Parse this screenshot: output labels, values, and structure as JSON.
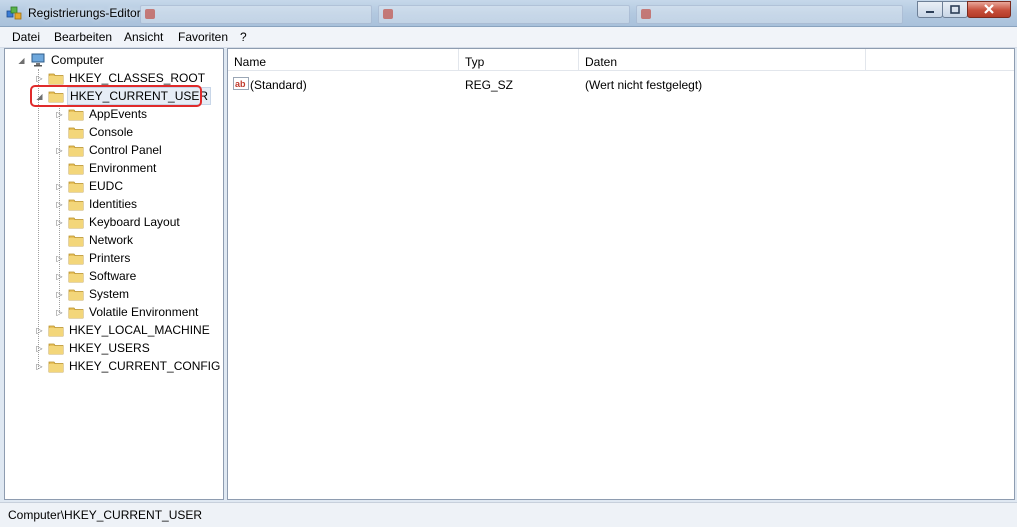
{
  "window": {
    "title": "Registrierungs-Editor",
    "buttons": {
      "minimize": "minimize",
      "maximize": "maximize",
      "close": "close"
    }
  },
  "menu": {
    "items": [
      {
        "label": "Datei"
      },
      {
        "label": "Bearbeiten"
      },
      {
        "label": "Ansicht"
      },
      {
        "label": "Favoriten"
      },
      {
        "label": "?"
      }
    ]
  },
  "tree": {
    "root": "Computer",
    "hives": {
      "classes_root": "HKEY_CLASSES_ROOT",
      "current_user": "HKEY_CURRENT_USER",
      "local_machine": "HKEY_LOCAL_MACHINE",
      "users": "HKEY_USERS",
      "current_config": "HKEY_CURRENT_CONFIG"
    },
    "current_user_children": [
      "AppEvents",
      "Console",
      "Control Panel",
      "Environment",
      "EUDC",
      "Identities",
      "Keyboard Layout",
      "Network",
      "Printers",
      "Software",
      "System",
      "Volatile Environment"
    ]
  },
  "list": {
    "columns": {
      "name": "Name",
      "type": "Typ",
      "data": "Daten"
    },
    "rows": [
      {
        "name": "(Standard)",
        "type": "REG_SZ",
        "data": "(Wert nicht festgelegt)",
        "icon": "string-value-icon"
      }
    ]
  },
  "status": {
    "path": "Computer\\HKEY_CURRENT_USER"
  },
  "colors": {
    "highlight_ring": "#e02b2b",
    "folder": "#e8c15a"
  }
}
